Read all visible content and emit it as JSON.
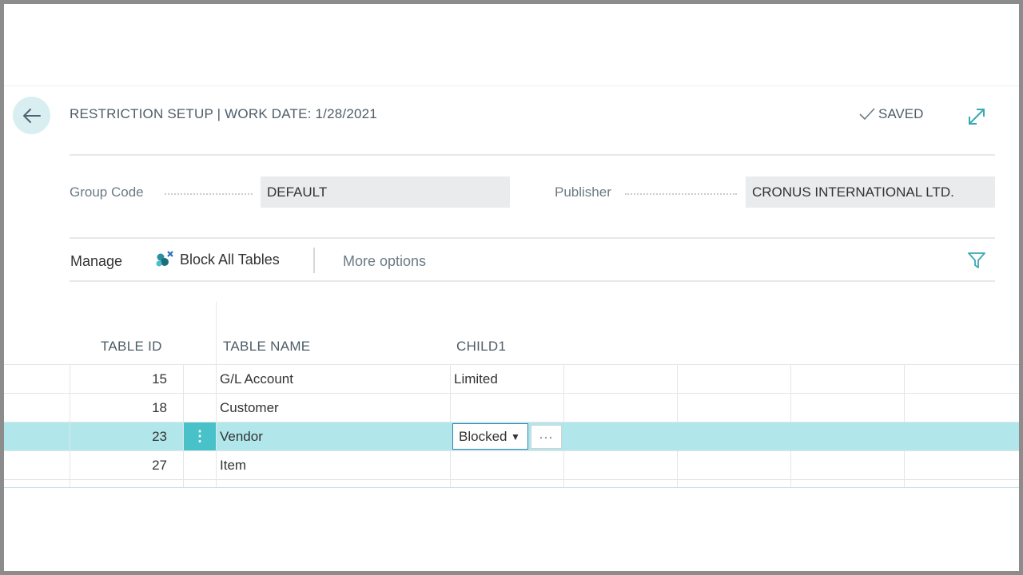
{
  "header": {
    "title": "RESTRICTION SETUP | WORK DATE: 1/28/2021",
    "saved_label": "SAVED"
  },
  "fields": {
    "group_code_label": "Group Code",
    "group_code_value": "DEFAULT",
    "publisher_label": "Publisher",
    "publisher_value": "CRONUS INTERNATIONAL LTD."
  },
  "actions": {
    "manage_label": "Manage",
    "block_all_label": "Block All Tables",
    "more_options_label": "More options"
  },
  "grid": {
    "columns": [
      "TABLE ID",
      "TABLE NAME",
      "CHILD1"
    ],
    "rows": [
      {
        "id": "15",
        "name": "G/L Account",
        "child1": "Limited"
      },
      {
        "id": "18",
        "name": "Customer",
        "child1": ""
      },
      {
        "id": "23",
        "name": "Vendor",
        "child1": "Blocked",
        "selected": true
      },
      {
        "id": "27",
        "name": "Item",
        "child1": ""
      }
    ],
    "lookup_label": "···",
    "row_menu_label": "⋮"
  },
  "icons": {
    "back": "back-arrow-icon",
    "saved_check": "checkmark-icon",
    "expand": "expand-icon",
    "block_all": "block-tables-icon",
    "filter": "filter-icon"
  },
  "colors": {
    "accent": "#49c1c9",
    "selected_row": "#b1e7eb",
    "back_button_bg": "#d9eef1"
  }
}
